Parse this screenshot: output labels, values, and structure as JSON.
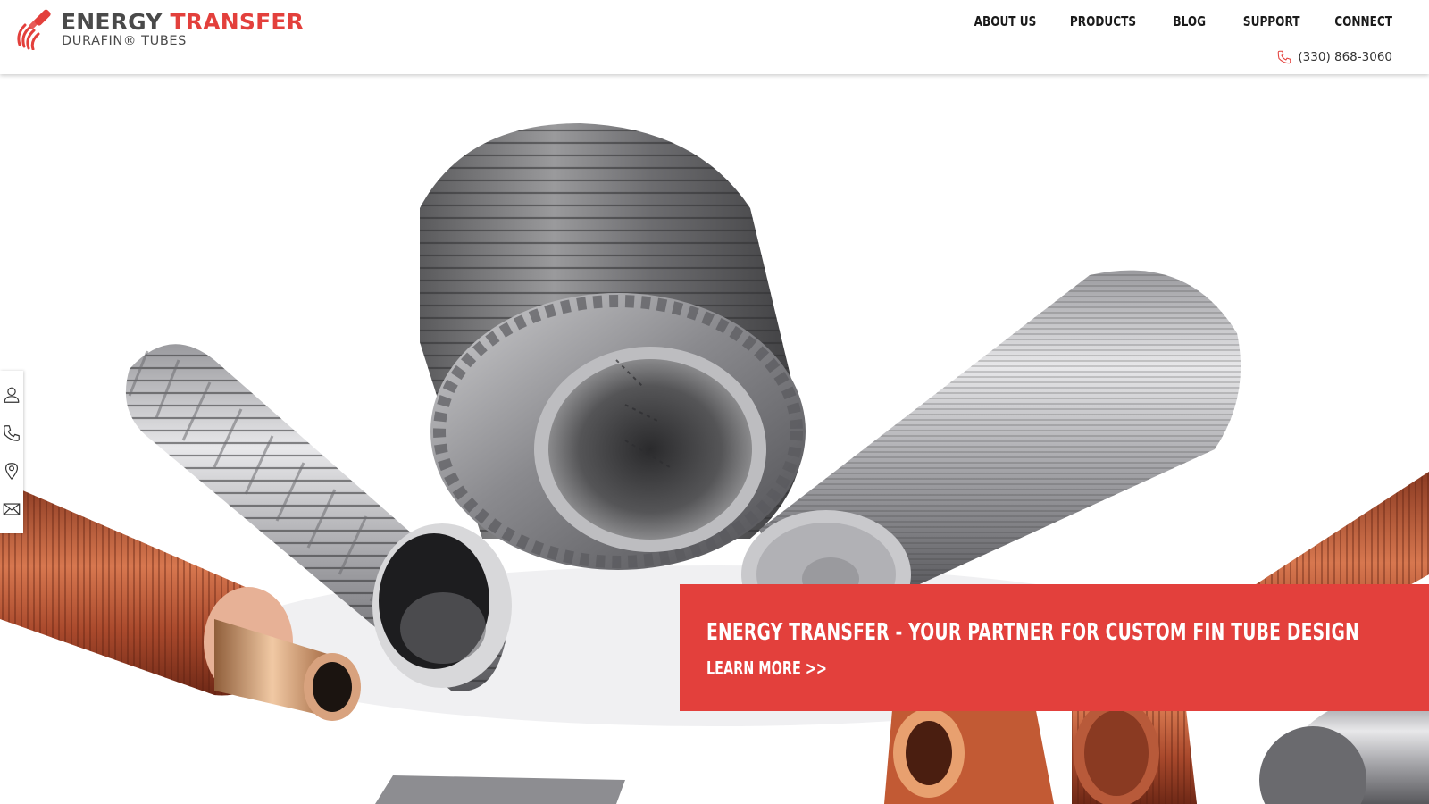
{
  "brand": {
    "title_word1": "ENERGY",
    "title_word2": "TRANSFER",
    "subtitle": "DURAFIN® TUBES",
    "accent_color": "#e3403c",
    "dark_color": "#4a4a4a"
  },
  "nav": {
    "items": [
      {
        "label": "ABOUT US"
      },
      {
        "label": "PRODUCTS"
      },
      {
        "label": "BLOG"
      },
      {
        "label": "SUPPORT"
      },
      {
        "label": "CONNECT"
      }
    ],
    "phone": "(330) 868-3060",
    "phone_icon": "phone-icon"
  },
  "side_bar": {
    "icons": [
      "user-icon",
      "phone-icon",
      "location-pin-icon",
      "mail-icon"
    ]
  },
  "hero": {
    "image_subject": "finned heat exchanger tubes",
    "cta_headline": "ENERGY TRANSFER - YOUR PARTNER FOR CUSTOM FIN TUBE DESIGN",
    "cta_link": "LEARN MORE >>"
  }
}
